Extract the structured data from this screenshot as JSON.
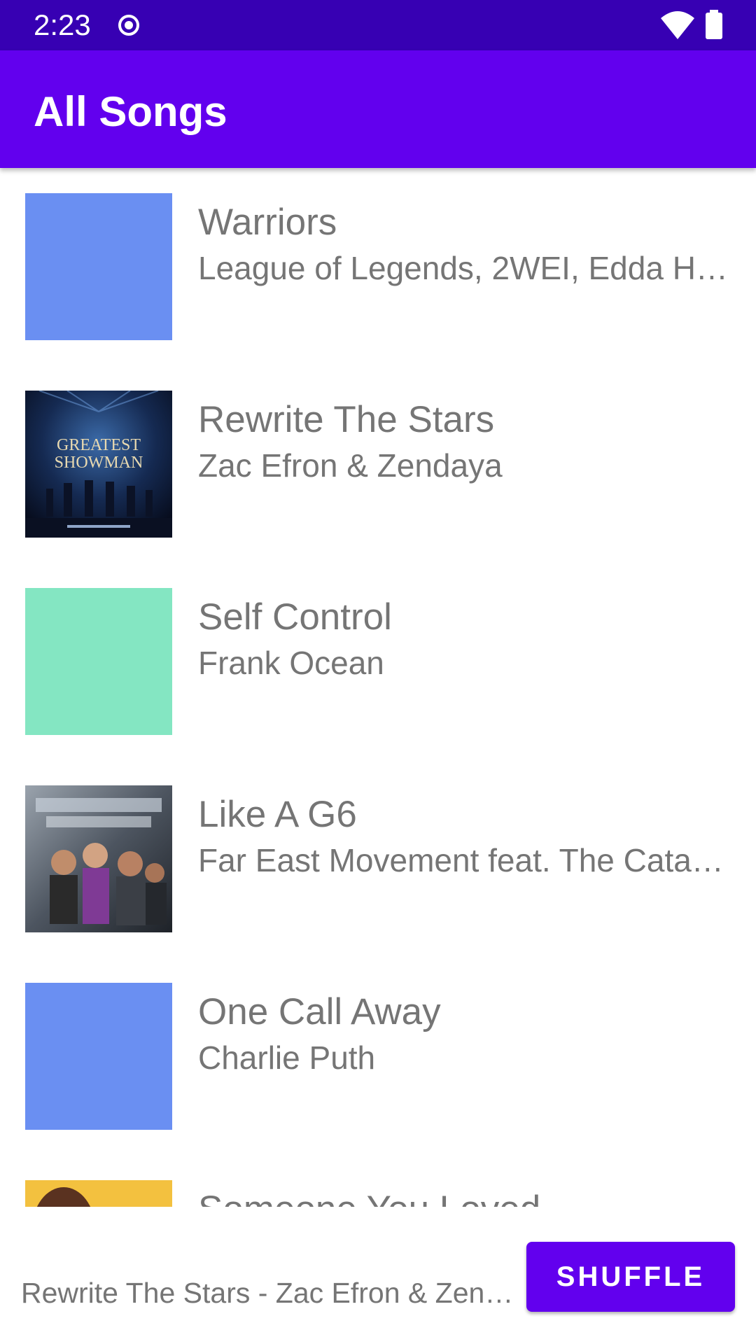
{
  "status_bar": {
    "time": "2:23",
    "icons": [
      "record-icon",
      "wifi-icon",
      "battery-icon"
    ],
    "color": "#3700b3"
  },
  "app_bar": {
    "title": "All Songs",
    "color": "#6200ee"
  },
  "songs": [
    {
      "title": "Warriors",
      "artist": "League of Legends, 2WEI, Edda H…",
      "art": "placeholder",
      "art_color": "#6a8ff2"
    },
    {
      "title": "Rewrite The Stars",
      "artist": "Zac Efron & Zendaya",
      "art": "album-cover",
      "art_text": "THE GREATEST SHOWMAN"
    },
    {
      "title": "Self Control",
      "artist": "Frank Ocean",
      "art": "placeholder",
      "art_color": "#84e6c2"
    },
    {
      "title": "Like A G6",
      "artist": "Far East Movement feat. The Cata…",
      "art": "album-cover"
    },
    {
      "title": "One Call Away",
      "artist": "Charlie Puth",
      "art": "placeholder",
      "art_color": "#6a8ff2"
    },
    {
      "title": "Someone You Loved",
      "artist": "",
      "art": "album-cover"
    }
  ],
  "bottom_bar": {
    "now_playing": "Rewrite The Stars - Zac Efron & Zend…",
    "shuffle_label": "SHUFFLE"
  }
}
